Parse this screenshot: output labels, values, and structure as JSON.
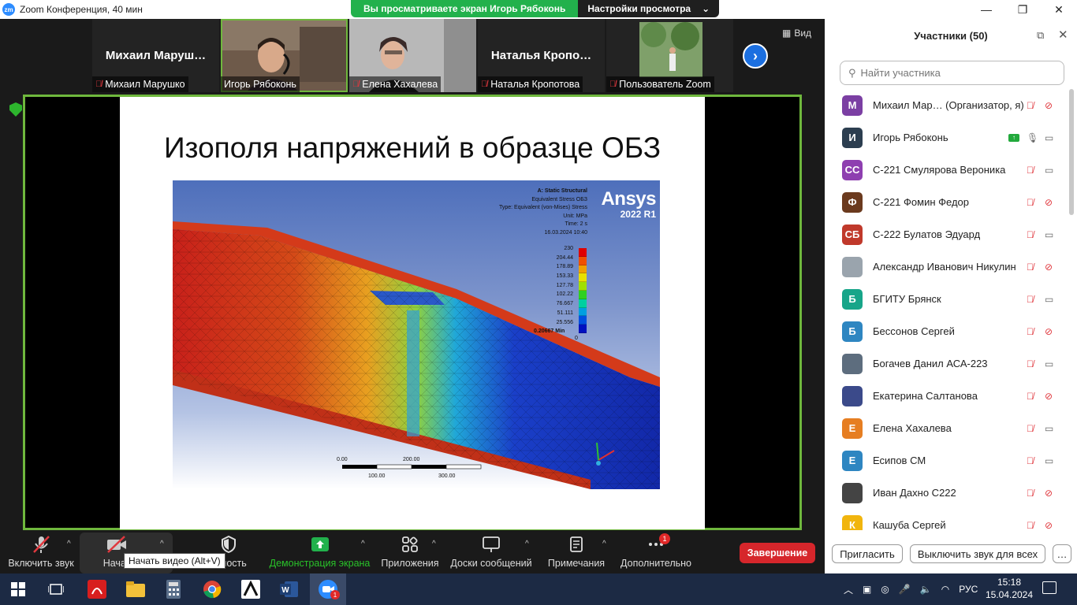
{
  "window": {
    "title": "Zoom Конференция, 40 мин",
    "app_icon_text": "zm",
    "minimize": "—",
    "maximize": "❐",
    "close": "✕"
  },
  "share_banner": {
    "text": "Вы просматриваете экран Игорь Рябоконь",
    "settings": "Настройки просмотра",
    "chevron": "⌄"
  },
  "strip": {
    "tiles": [
      {
        "big_name": "Михаил  Маруш…",
        "name": "Михаил Марушко",
        "muted": true
      },
      {
        "big_name": "",
        "name": "Игорь Рябоконь",
        "muted": false,
        "active": true
      },
      {
        "big_name": "",
        "name": "Елена Хахалева",
        "muted": true
      },
      {
        "big_name": "Наталья  Кропо…",
        "name": "Наталья Кропотова",
        "muted": true
      },
      {
        "big_name": "",
        "name": "Пользователь Zoom",
        "muted": true
      }
    ],
    "next": "›",
    "view_label": "Вид"
  },
  "slide": {
    "title": "Изополя напряжений  в образце ОБЗ",
    "sim_info": [
      "A: Static Structural",
      "Equivalent Stress ОБЗ",
      "Type: Equivalent (von-Mises) Stress",
      "Unit: MPa",
      "Time: 2 s",
      "16.03.2024 10:40"
    ],
    "brand": "Ansys",
    "version": "2022 R1",
    "legend_values": [
      "230",
      "204.44",
      "178.89",
      "153.33",
      "127.78",
      "102.22",
      "76.667",
      "51.111",
      "25.556",
      "0.20667 Min"
    ],
    "legend_min_value": "0",
    "legend_colors": [
      "#e00000",
      "#f05000",
      "#f0a000",
      "#e8e000",
      "#a0e000",
      "#30d020",
      "#00d0a0",
      "#00a0e0",
      "#0050e0",
      "#0010c0"
    ],
    "scale_labels": [
      "0.00",
      "200.00",
      "100.00",
      "300.00"
    ]
  },
  "toolbar": {
    "audio": "Включить звук",
    "video": "Начат",
    "security": "асность",
    "share": "Демонстрация экрана",
    "apps": "Приложения",
    "whiteboard": "Доски сообщений",
    "notes": "Примечания",
    "more": "Дополнительно",
    "more_badge": "1",
    "end": "Завершение",
    "tooltip": "Начать видео (Alt+V)"
  },
  "panel": {
    "title": "Участники (50)",
    "search_placeholder": "Найти участника",
    "participants": [
      {
        "initial": "М",
        "name": "Михаил Мар… (Организатор, я)",
        "color": "#7b3fa3",
        "mic": "off",
        "cam": "off"
      },
      {
        "initial": "И",
        "name": "Игорь Рябоконь",
        "color": "#2c3e50",
        "mic": "on",
        "cam": "on",
        "sharing": true
      },
      {
        "initial": "СС",
        "name": "С-221 Смулярова Вероника",
        "color": "#8e3fb0",
        "mic": "off",
        "cam": "on"
      },
      {
        "initial": "Ф",
        "name": "С-221 Фомин Федор",
        "color": "#6b3a1e",
        "mic": "off",
        "cam": "off"
      },
      {
        "initial": "СБ",
        "name": "С-222 Булатов Эдуард",
        "color": "#c0392b",
        "mic": "off",
        "cam": "on"
      },
      {
        "initial": "",
        "name": "Александр Иванович Никулин",
        "color": "#9aa4ad",
        "mic": "off",
        "cam": "off",
        "photo": true
      },
      {
        "initial": "Б",
        "name": "БГИТУ Брянск",
        "color": "#17a589",
        "mic": "off",
        "cam": "on"
      },
      {
        "initial": "Б",
        "name": "Бессонов Сергей",
        "color": "#2e86c1",
        "mic": "off",
        "cam": "off"
      },
      {
        "initial": "",
        "name": "Богачев Данил АСА-223",
        "color": "#5d6d7e",
        "mic": "off",
        "cam": "on",
        "photo": true
      },
      {
        "initial": "",
        "name": "Екатерина Салтанова",
        "color": "#3b4a8a",
        "mic": "off",
        "cam": "off",
        "photo": true
      },
      {
        "initial": "Е",
        "name": "Елена Хахалева",
        "color": "#e67e22",
        "mic": "off",
        "cam": "on"
      },
      {
        "initial": "Е",
        "name": "Есипов СМ",
        "color": "#2e86c1",
        "mic": "off",
        "cam": "on"
      },
      {
        "initial": "",
        "name": "Иван Дахно С222",
        "color": "#444444",
        "mic": "off",
        "cam": "off",
        "photo": true
      },
      {
        "initial": "К",
        "name": "Кашуба Сергей",
        "color": "#f1b50e",
        "mic": "off",
        "cam": "off"
      }
    ],
    "invite": "Пригласить",
    "mute_all": "Выключить звук для всех",
    "more": "…"
  },
  "taskbar": {
    "apps": [
      "windows-start",
      "task-view",
      "acrobat",
      "explorer",
      "calculator",
      "chrome",
      "autocad",
      "word",
      "zoom"
    ],
    "zoom_badge": "1",
    "lang": "РУС",
    "time": "15:18",
    "date": "15.04.2024"
  }
}
